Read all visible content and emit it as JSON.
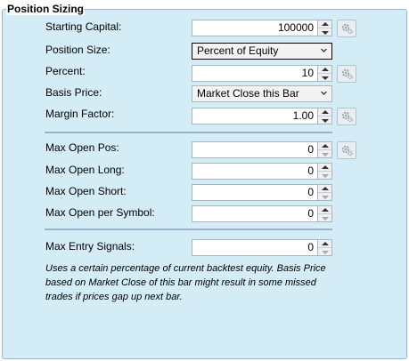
{
  "group": {
    "title": "Position Sizing"
  },
  "fields": {
    "starting_capital": {
      "label": "Starting Capital:",
      "value": "100000"
    },
    "position_size": {
      "label": "Position Size:",
      "value": "Percent of Equity"
    },
    "percent": {
      "label": "Percent:",
      "value": "10"
    },
    "basis_price": {
      "label": "Basis Price:",
      "value": "Market Close this Bar"
    },
    "margin_factor": {
      "label": "Margin Factor:",
      "value": "1.00"
    },
    "max_open_pos": {
      "label": "Max Open Pos:",
      "value": "0"
    },
    "max_open_long": {
      "label": "Max Open Long:",
      "value": "0"
    },
    "max_open_short": {
      "label": "Max Open Short:",
      "value": "0"
    },
    "max_open_per_symbol": {
      "label": "Max Open per Symbol:",
      "value": "0"
    },
    "max_entry_signals": {
      "label": "Max Entry Signals:",
      "value": "0"
    }
  },
  "note": "Uses a certain percentage of current backtest equity. Basis Price based on Market Close of this bar might result in some missed trades if prices gap up next bar.",
  "colors": {
    "panel_bg": "#d3ecf6",
    "divider": "#9ab2c6"
  }
}
